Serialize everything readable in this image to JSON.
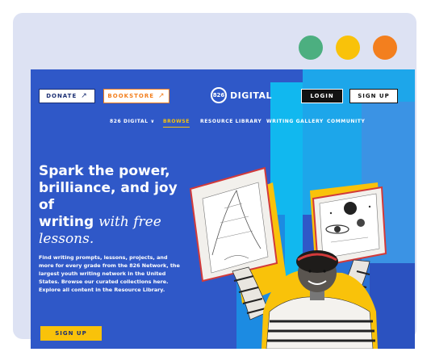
{
  "window": {
    "dots": [
      "green",
      "yellow",
      "orange"
    ]
  },
  "header": {
    "donate_label": "DONATE",
    "bookstore_label": "BOOKSTORE",
    "logo_mark": "826",
    "logo_text": "DIGITAL",
    "login_label": "LOGIN",
    "signup_label": "SIGN UP",
    "arrow_icon": "↗"
  },
  "nav": {
    "items": [
      "826 DIGITAL",
      "BROWSE",
      "RESOURCE LIBRARY",
      "WRITING GALLERY",
      "COMMUNITY"
    ],
    "chevron": "∨"
  },
  "hero": {
    "line1": "Spark the power,",
    "line2": "brilliance, and joy of",
    "line3a": "writing ",
    "line3b": "with free",
    "line4": "lessons.",
    "body": "Find writing prompts, lessons, projects, and more for every grade from the 826 Network, the largest youth writing network in the United States. Browse our curated collections here. Explore all content in the Resource Library.",
    "cta_label": "SIGN UP"
  },
  "colors": {
    "primary_blue": "#2f58c8",
    "yellow": "#f9c20a",
    "orange": "#f37f1e",
    "green": "#4caf80"
  }
}
